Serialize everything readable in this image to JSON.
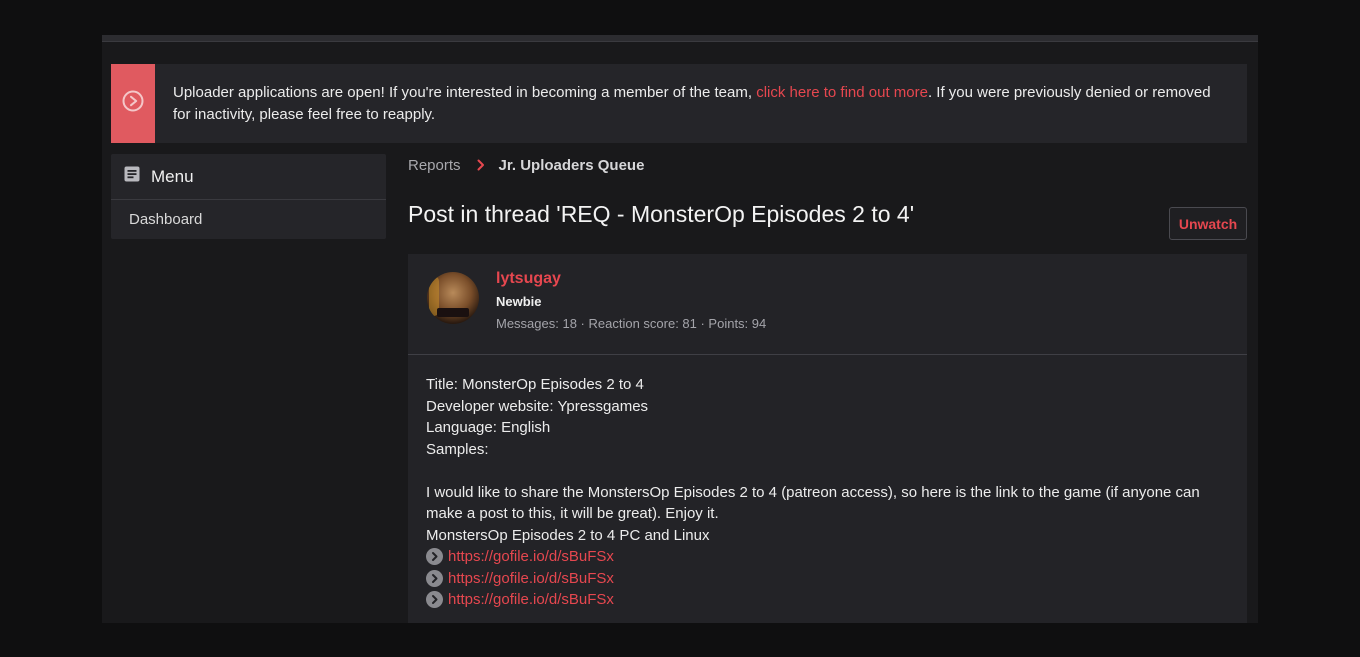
{
  "notice": {
    "text_before": "Uploader applications are open! If you're interested in becoming a member of the team, ",
    "link_text": "click here to find out more",
    "text_after": ". If you were previously denied or removed for inactivity, please feel free to reapply.",
    "icon": "play-circle-icon"
  },
  "sidebar": {
    "menu_label": "Menu",
    "menu_icon": "menu-list-icon",
    "items": [
      {
        "label": "Dashboard"
      }
    ]
  },
  "breadcrumb": {
    "items": [
      {
        "label": "Reports"
      }
    ],
    "current": "Jr. Uploaders Queue"
  },
  "page": {
    "title": "Post in thread 'REQ - MonsterOp Episodes 2 to 4'",
    "unwatch_label": "Unwatch"
  },
  "post": {
    "username": "lytsugay",
    "user_title": "Newbie",
    "stats": "Messages: 18 · Reaction score: 81 · Points: 94",
    "lines": [
      "Title: MonsterOp Episodes 2 to 4",
      "Developer website: Ypressgames",
      "Language: English",
      "Samples:"
    ],
    "paragraph": "I would like to share the MonstersOp Episodes 2 to 4 (patreon access), so here is the link to the game (if anyone can make a post to this, it will be great). Enjoy it.",
    "subheading": "MonstersOp Episodes 2 to 4 PC and Linux",
    "links": [
      "https://gofile.io/d/sBuFSx",
      "https://gofile.io/d/sBuFSx",
      "https://gofile.io/d/sBuFSx"
    ]
  },
  "colors": {
    "accent": "#e6474f",
    "notice_bar": "#e05a60",
    "panel": "#252529",
    "background": "#0f0f10"
  }
}
